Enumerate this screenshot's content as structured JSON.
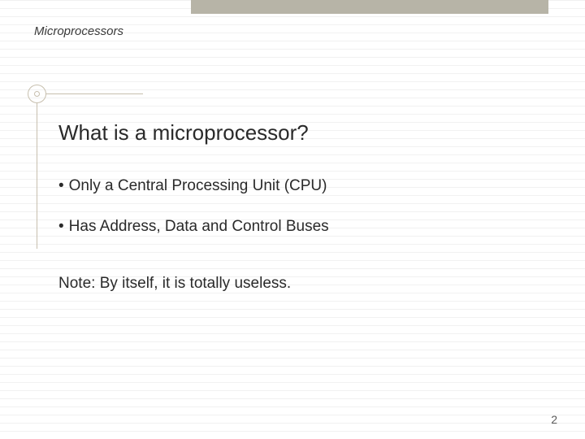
{
  "header": {
    "label": "Microprocessors"
  },
  "title": "What is a microprocessor?",
  "bullets": [
    "Only a Central Processing Unit (CPU)",
    "Has Address, Data and Control Buses"
  ],
  "note": "Note: By itself, it is totally useless.",
  "page": "2"
}
